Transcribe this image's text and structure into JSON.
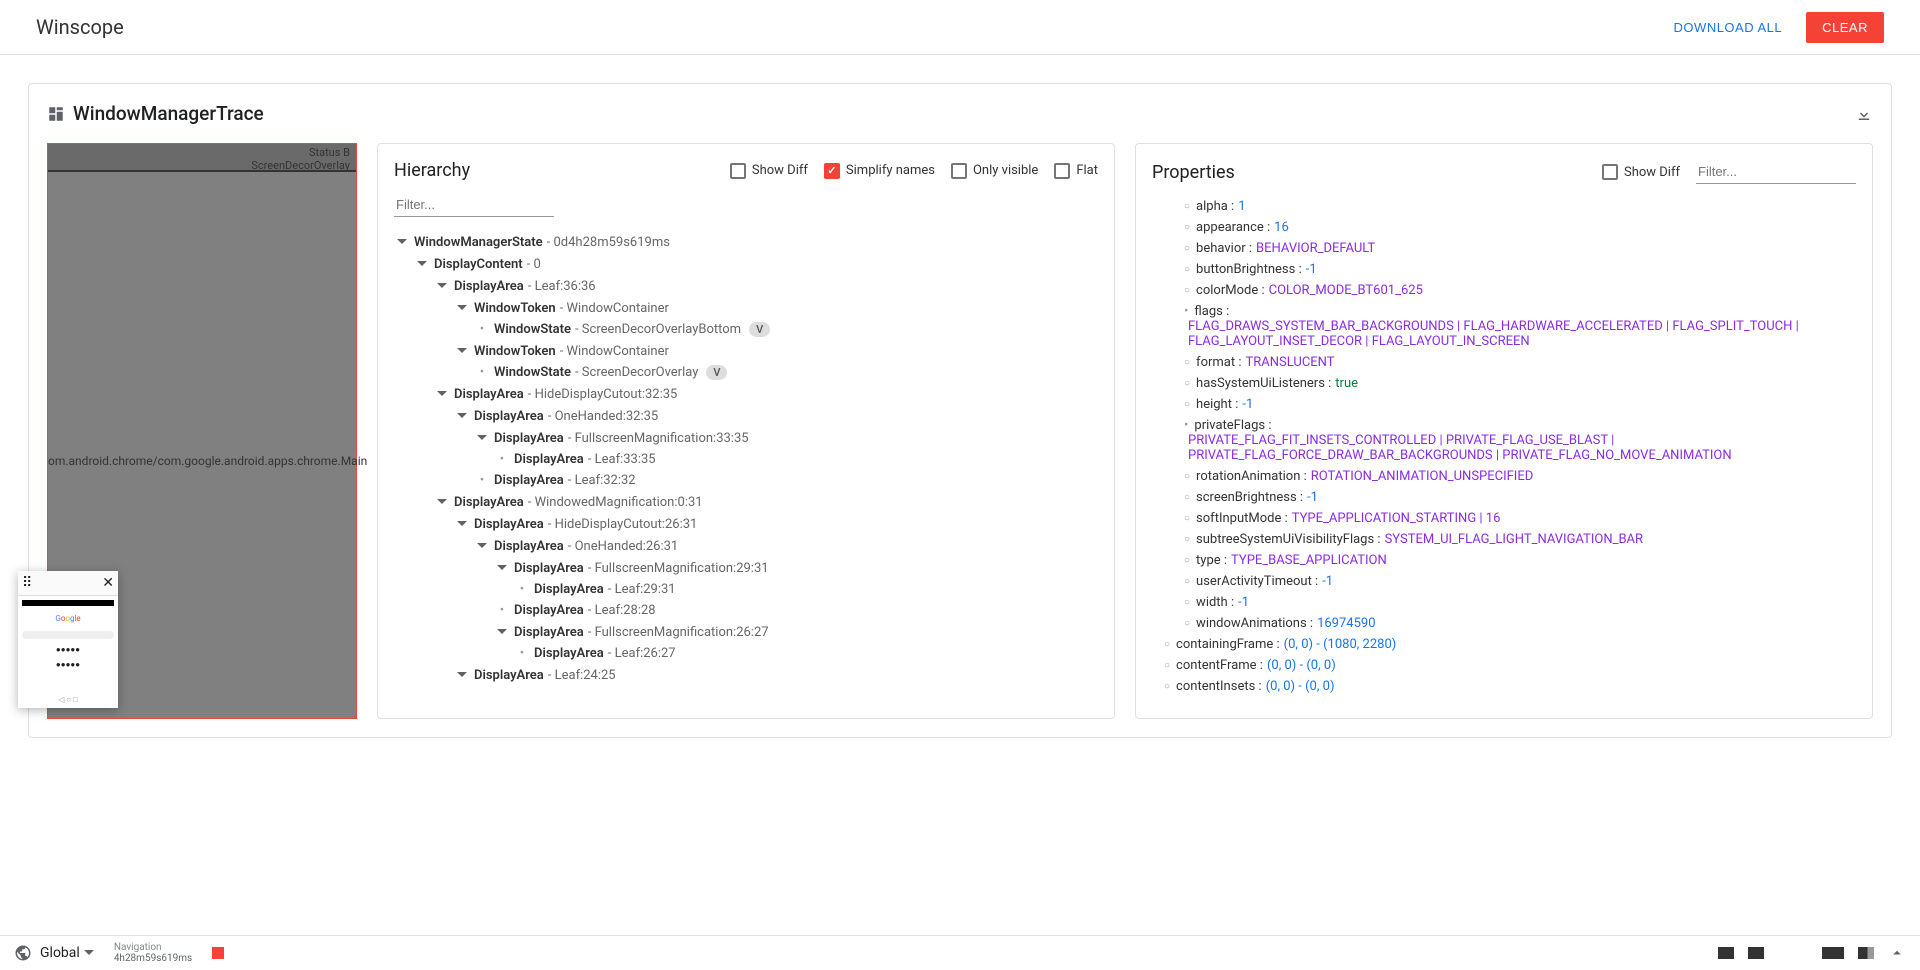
{
  "app_title": "Winscope",
  "header": {
    "download_all": "DOWNLOAD ALL",
    "clear": "CLEAR"
  },
  "trace": {
    "title": "WindowManagerTrace"
  },
  "hierarchy": {
    "title": "Hierarchy",
    "show_diff": "Show Diff",
    "simplify": "Simplify names",
    "only_visible": "Only visible",
    "flat": "Flat",
    "filter_placeholder": "Filter..."
  },
  "properties": {
    "title": "Properties",
    "show_diff": "Show Diff",
    "filter_placeholder": "Filter..."
  },
  "preview": {
    "status1": "Status B",
    "status2": "ScreenDecorOverlay",
    "chrome_text": "om.android.chrome/com.google.android.apps.chrome.Main"
  },
  "tree": [
    {
      "depth": 0,
      "arrow": true,
      "name": "WindowManagerState",
      "suffix": "0d4h28m59s619ms"
    },
    {
      "depth": 1,
      "arrow": true,
      "name": "DisplayContent",
      "suffix": "0"
    },
    {
      "depth": 2,
      "arrow": true,
      "name": "DisplayArea",
      "suffix": "Leaf:36:36"
    },
    {
      "depth": 3,
      "arrow": true,
      "name": "WindowToken",
      "suffix": "WindowContainer"
    },
    {
      "depth": 4,
      "dot": true,
      "name": "WindowState",
      "suffix": "ScreenDecorOverlayBottom",
      "badge": "V"
    },
    {
      "depth": 3,
      "arrow": true,
      "name": "WindowToken",
      "suffix": "WindowContainer"
    },
    {
      "depth": 4,
      "dot": true,
      "name": "WindowState",
      "suffix": "ScreenDecorOverlay",
      "badge": "V"
    },
    {
      "depth": 2,
      "arrow": true,
      "name": "DisplayArea",
      "suffix": "HideDisplayCutout:32:35"
    },
    {
      "depth": 3,
      "arrow": true,
      "name": "DisplayArea",
      "suffix": "OneHanded:32:35"
    },
    {
      "depth": 4,
      "arrow": true,
      "name": "DisplayArea",
      "suffix": "FullscreenMagnification:33:35"
    },
    {
      "depth": 5,
      "dot": true,
      "name": "DisplayArea",
      "suffix": "Leaf:33:35"
    },
    {
      "depth": 4,
      "dot": true,
      "name": "DisplayArea",
      "suffix": "Leaf:32:32"
    },
    {
      "depth": 2,
      "arrow": true,
      "name": "DisplayArea",
      "suffix": "WindowedMagnification:0:31"
    },
    {
      "depth": 3,
      "arrow": true,
      "name": "DisplayArea",
      "suffix": "HideDisplayCutout:26:31"
    },
    {
      "depth": 4,
      "arrow": true,
      "name": "DisplayArea",
      "suffix": "OneHanded:26:31"
    },
    {
      "depth": 5,
      "arrow": true,
      "name": "DisplayArea",
      "suffix": "FullscreenMagnification:29:31"
    },
    {
      "depth": 6,
      "dot": true,
      "name": "DisplayArea",
      "suffix": "Leaf:29:31"
    },
    {
      "depth": 5,
      "dot": true,
      "name": "DisplayArea",
      "suffix": "Leaf:28:28"
    },
    {
      "depth": 5,
      "arrow": true,
      "name": "DisplayArea",
      "suffix": "FullscreenMagnification:26:27"
    },
    {
      "depth": 6,
      "dot": true,
      "name": "DisplayArea",
      "suffix": "Leaf:26:27"
    },
    {
      "depth": 3,
      "arrow": true,
      "name": "DisplayArea",
      "suffix": "Leaf:24:25"
    }
  ],
  "props": [
    {
      "k": "alpha",
      "v": "1",
      "cls": "val-blue",
      "hollow": true
    },
    {
      "k": "appearance",
      "v": "16",
      "cls": "val-blue",
      "hollow": true
    },
    {
      "k": "behavior",
      "v": "BEHAVIOR_DEFAULT",
      "cls": "val-purple",
      "hollow": true
    },
    {
      "k": "buttonBrightness",
      "v": "-1",
      "cls": "val-blue",
      "hollow": true
    },
    {
      "k": "colorMode",
      "v": "COLOR_MODE_BT601_625",
      "cls": "val-purple",
      "hollow": true
    },
    {
      "k": "flags",
      "v": "FLAG_DRAWS_SYSTEM_BAR_BACKGROUNDS | FLAG_HARDWARE_ACCELERATED | FLAG_SPLIT_TOUCH | FLAG_LAYOUT_INSET_DECOR | FLAG_LAYOUT_IN_SCREEN",
      "cls": "val-purple"
    },
    {
      "k": "format",
      "v": "TRANSLUCENT",
      "cls": "val-purple",
      "hollow": true
    },
    {
      "k": "hasSystemUiListeners",
      "v": "true",
      "cls": "val-green",
      "hollow": true
    },
    {
      "k": "height",
      "v": "-1",
      "cls": "val-blue",
      "hollow": true
    },
    {
      "k": "privateFlags",
      "v": "PRIVATE_FLAG_FIT_INSETS_CONTROLLED | PRIVATE_FLAG_USE_BLAST | PRIVATE_FLAG_FORCE_DRAW_BAR_BACKGROUNDS | PRIVATE_FLAG_NO_MOVE_ANIMATION",
      "cls": "val-purple"
    },
    {
      "k": "rotationAnimation",
      "v": "ROTATION_ANIMATION_UNSPECIFIED",
      "cls": "val-purple",
      "hollow": true
    },
    {
      "k": "screenBrightness",
      "v": "-1",
      "cls": "val-blue",
      "hollow": true
    },
    {
      "k": "softInputMode",
      "v": "TYPE_APPLICATION_STARTING | 16",
      "cls": "val-purple",
      "hollow": true
    },
    {
      "k": "subtreeSystemUiVisibilityFlags",
      "v": "SYSTEM_UI_FLAG_LIGHT_NAVIGATION_BAR",
      "cls": "val-purple",
      "hollow": true
    },
    {
      "k": "type",
      "v": "TYPE_BASE_APPLICATION",
      "cls": "val-purple",
      "hollow": true
    },
    {
      "k": "userActivityTimeout",
      "v": "-1",
      "cls": "val-blue",
      "hollow": true
    },
    {
      "k": "width",
      "v": "-1",
      "cls": "val-blue",
      "hollow": true
    },
    {
      "k": "windowAnimations",
      "v": "16974590",
      "cls": "val-blue",
      "hollow": true
    }
  ],
  "props_outer": [
    {
      "k": "containingFrame",
      "v": "(0, 0) - (1080, 2280)",
      "cls": "val-blue",
      "hollow": true
    },
    {
      "k": "contentFrame",
      "v": "(0, 0) - (0, 0)",
      "cls": "val-blue",
      "hollow": true
    },
    {
      "k": "contentInsets",
      "v": "(0, 0) - (0, 0)",
      "cls": "val-blue",
      "hollow": true
    }
  ],
  "footer": {
    "global": "Global",
    "nav_label": "Navigation",
    "nav_time": "4h28m59s619ms"
  }
}
